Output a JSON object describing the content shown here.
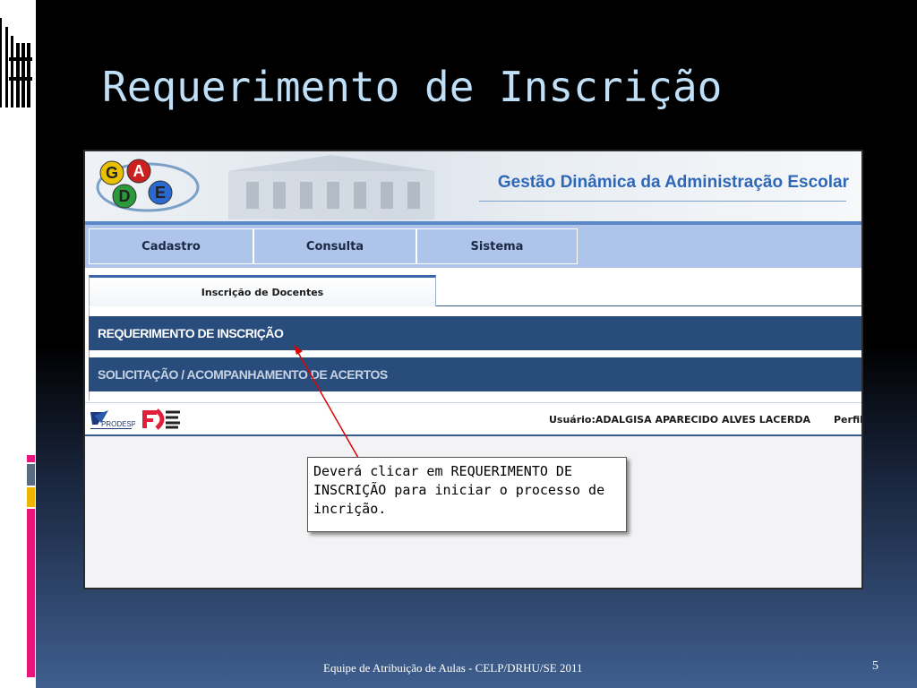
{
  "slide": {
    "title": "Requerimento de Inscrição",
    "footer": "Equipe de Atribuição de Aulas - CELP/DRHU/SE  2011",
    "number": "5"
  },
  "app": {
    "logo_letters": [
      "G",
      "A",
      "D",
      "E"
    ],
    "title": "Gestão Dinâmica da Administração Escolar",
    "menu": [
      "Cadastro",
      "Consulta",
      "Sistema"
    ],
    "tab": "Inscrição de Docentes",
    "sections": [
      "REQUERIMENTO DE INSCRIÇÃO",
      "SOLICITAÇÃO / ACOMPANHAMENTO DE ACERTOS"
    ],
    "footer": {
      "prodesp_label": "PRODESP",
      "user": "Usuário:ADALGISA APARECIDO ALVES LACERDA",
      "perfil": "Perfil"
    }
  },
  "callout": {
    "text": "Deverá clicar em REQUERIMENTO DE INSCRIÇÃO para iniciar o processo de incrição."
  },
  "colors": {
    "accent_pink": "#e8157a",
    "accent_gold": "#f0b400",
    "title_blue": "#bfe0f8",
    "section_bar": "#284d7c",
    "menu_bar": "#aec4ea",
    "app_title": "#2f67b8",
    "arrow": "#e00000"
  },
  "icons": [
    "window-icon",
    "gdae-logo",
    "prodesp-logo",
    "fde-logo"
  ]
}
